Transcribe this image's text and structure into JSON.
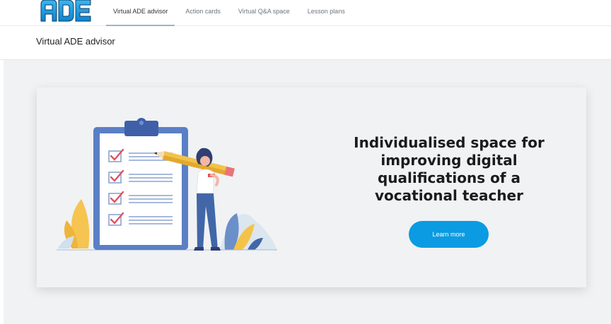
{
  "brand": {
    "logo_text": "ADE",
    "accent": "#1aa0e8"
  },
  "nav": {
    "tabs": [
      {
        "label": "Virtual ADE advisor",
        "active": true
      },
      {
        "label": "Action cards",
        "active": false
      },
      {
        "label": "Virtual Q&A space",
        "active": false
      },
      {
        "label": "Lesson plans",
        "active": false
      }
    ]
  },
  "page": {
    "title": "Virtual ADE advisor"
  },
  "hero": {
    "heading": "Individualised space for improving digital qualifications of a vocational teacher",
    "button_label": "Learn more",
    "button_color": "#0a9be2",
    "illustration": "checklist-with-woman-holding-pencil"
  }
}
